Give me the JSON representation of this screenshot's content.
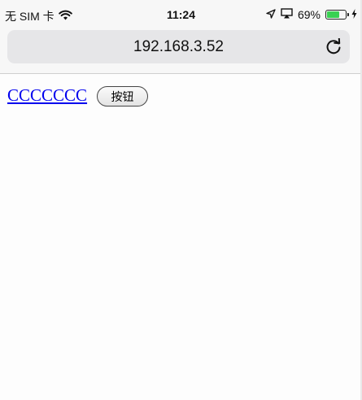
{
  "status_bar": {
    "carrier": "无 SIM 卡",
    "time": "11:24",
    "battery_percent_text": "69%",
    "battery_level": 0.69,
    "battery_color": "#39d152",
    "icons": [
      "wifi-icon",
      "location-arrow-icon",
      "airplay-icon",
      "battery-icon",
      "charging-bolt-icon"
    ]
  },
  "browser": {
    "url": "192.168.3.52",
    "reload_icon": "reload-icon"
  },
  "page": {
    "link_text": "CCCCCCC",
    "link_color": "#0000ee",
    "button_label": "按钮"
  }
}
